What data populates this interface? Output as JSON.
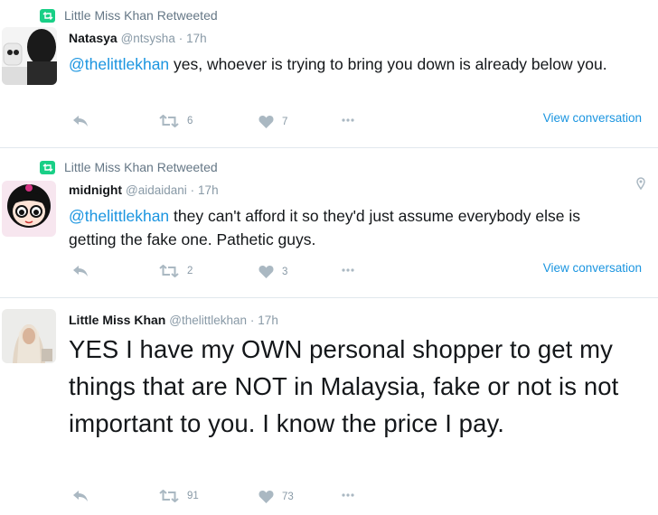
{
  "tweets": [
    {
      "retweet_context": "Little Miss Khan Retweeted",
      "fullname": "Natasya",
      "handle": "@ntsysha",
      "dot": "·",
      "time": "17h",
      "mention": "@thelittlekhan",
      "text": " yes, whoever is trying to bring you down is already below you.",
      "retweets": "6",
      "likes": "7",
      "view_conversation": "View conversation"
    },
    {
      "retweet_context": "Little Miss Khan Retweeted",
      "fullname": "midnight",
      "handle": "@aidaidani",
      "dot": "·",
      "time": "17h",
      "mention": "@thelittlekhan",
      "text": " they can't afford it so they'd just assume everybody else is getting the fake one. Pathetic guys.",
      "retweets": "2",
      "likes": "3",
      "view_conversation": "View conversation"
    },
    {
      "fullname": "Little Miss Khan",
      "handle": "@thelittlekhan",
      "dot": "·",
      "time": "17h",
      "text": "YES I have my OWN personal shopper to get my things that are NOT in Malaysia, fake or not is not important to you. I know the price I pay.",
      "retweets": "91",
      "likes": "73"
    }
  ],
  "icons": {
    "reply": "reply-icon",
    "retweet": "retweet-icon",
    "like": "heart-icon",
    "more": "more-icon",
    "retweet_badge": "retweet-badge-icon",
    "geo": "location-pin-icon"
  },
  "colors": {
    "link": "#1b95e0",
    "retweet_green": "#19cf86",
    "muted": "#8899a6",
    "icon_grey": "#aab8c2"
  }
}
